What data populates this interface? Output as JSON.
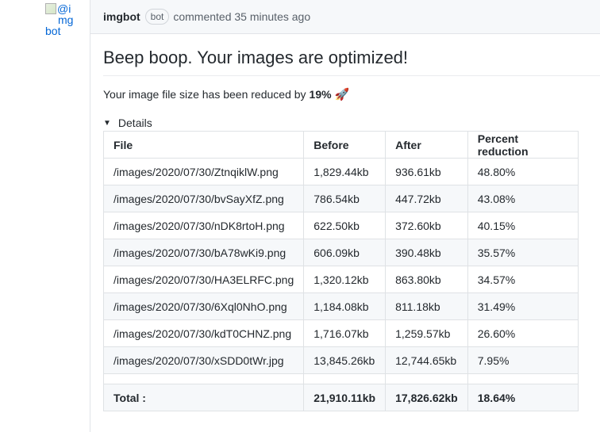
{
  "avatar": {
    "alt": "@imgbot",
    "alt_line1": "@i",
    "alt_line2": "mg",
    "alt_line3": "bot"
  },
  "comment": {
    "author": "imgbot",
    "badge": "bot",
    "action": "commented 35 minutes ago",
    "title": "Beep boop. Your images are optimized!",
    "summary_prefix": "Your image file size has been reduced by",
    "summary_percent": "19%",
    "details_label": "Details"
  },
  "table": {
    "headers": [
      "File",
      "Before",
      "After",
      "Percent reduction"
    ],
    "rows": [
      [
        "/images/2020/07/30/ZtnqiklW.png",
        "1,829.44kb",
        "936.61kb",
        "48.80%"
      ],
      [
        "/images/2020/07/30/bvSayXfZ.png",
        "786.54kb",
        "447.72kb",
        "43.08%"
      ],
      [
        "/images/2020/07/30/nDK8rtoH.png",
        "622.50kb",
        "372.60kb",
        "40.15%"
      ],
      [
        "/images/2020/07/30/bA78wKi9.png",
        "606.09kb",
        "390.48kb",
        "35.57%"
      ],
      [
        "/images/2020/07/30/HA3ELRFC.png",
        "1,320.12kb",
        "863.80kb",
        "34.57%"
      ],
      [
        "/images/2020/07/30/6Xql0NhO.png",
        "1,184.08kb",
        "811.18kb",
        "31.49%"
      ],
      [
        "/images/2020/07/30/kdT0CHNZ.png",
        "1,716.07kb",
        "1,259.57kb",
        "26.60%"
      ],
      [
        "/images/2020/07/30/xSDD0tWr.jpg",
        "13,845.26kb",
        "12,744.65kb",
        "7.95%"
      ]
    ],
    "total": [
      "Total :",
      "21,910.11kb",
      "17,826.62kb",
      "18.64%"
    ]
  }
}
